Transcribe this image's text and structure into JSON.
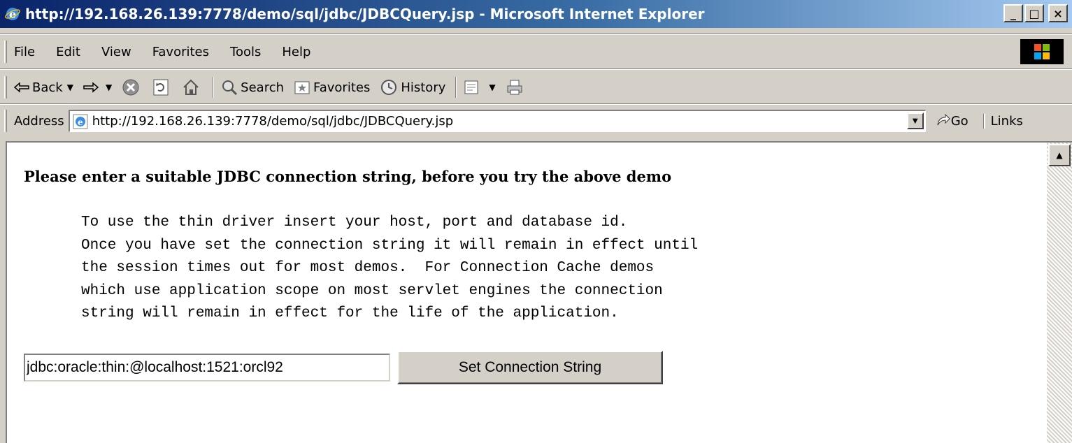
{
  "window": {
    "title": "http://192.168.26.139:7778/demo/sql/jdbc/JDBCQuery.jsp - Microsoft Internet Explorer",
    "minimize": "_",
    "maximize": "□",
    "close": "×"
  },
  "menu": [
    "File",
    "Edit",
    "View",
    "Favorites",
    "Tools",
    "Help"
  ],
  "toolbar": {
    "back": "Back",
    "search": "Search",
    "favorites": "Favorites",
    "history": "History"
  },
  "address": {
    "label": "Address",
    "url": "http://192.168.26.139:7778/demo/sql/jdbc/JDBCQuery.jsp",
    "go": "Go",
    "links": "Links"
  },
  "page": {
    "heading": "Please enter a suitable JDBC connection string, before you try the above demo",
    "instructions": [
      "To use the thin driver insert your host, port and database id.",
      "Once you have set the connection string it will remain in effect until",
      "the session times out for most demos.  For Connection Cache demos",
      "which use application scope on most servlet engines the connection",
      "string will remain in effect for the life of the application."
    ],
    "connection_value": "jdbc:oracle:thin:@localhost:1521:orcl92",
    "button_label": "Set Connection String"
  },
  "colors": {
    "title_gradient_start": "#0a246a",
    "title_gradient_end": "#a6caf0",
    "chrome": "#d4d0c8"
  }
}
